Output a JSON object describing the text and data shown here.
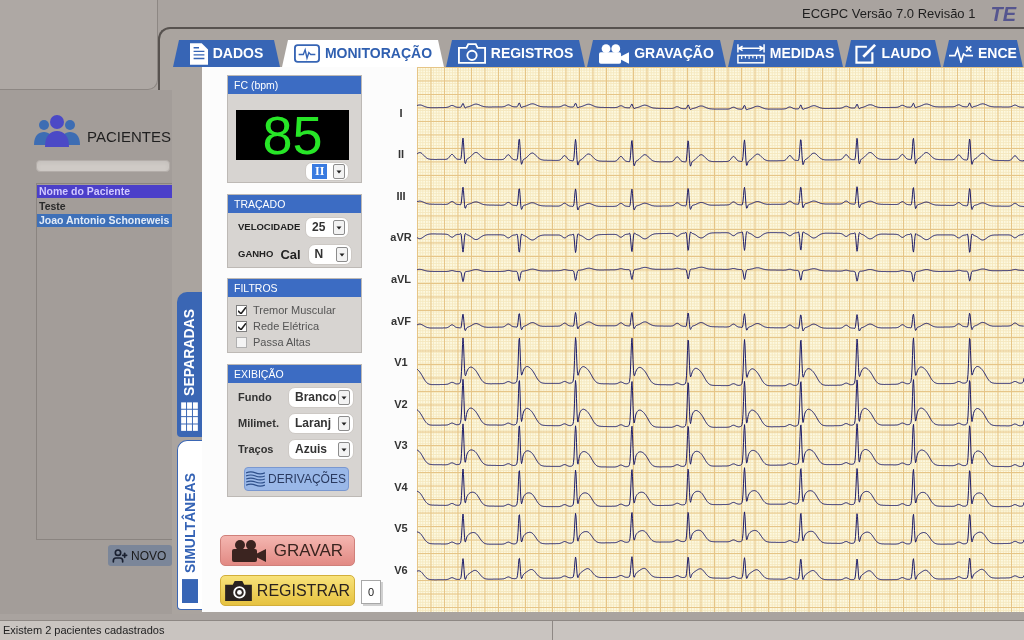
{
  "header": {
    "title": "ECGPC Versão 7.0 Revisão 1",
    "logo": "TE"
  },
  "patients": {
    "title": "PACIENTES",
    "list": {
      "column": "Nome do Paciente",
      "rows": [
        {
          "name": "Teste",
          "selected": false
        },
        {
          "name": "Joao Antonio Schoneweis",
          "selected": true
        }
      ]
    },
    "new_button": "NOVO"
  },
  "tabs": [
    {
      "label": "DADOS",
      "selected": false
    },
    {
      "label": "MONITORAÇÃO",
      "selected": true
    },
    {
      "label": "REGISTROS",
      "selected": false
    },
    {
      "label": "GRAVAÇÃO",
      "selected": false
    },
    {
      "label": "MEDIDAS",
      "selected": false
    },
    {
      "label": "LAUDO",
      "selected": false
    },
    {
      "label": "ENCE",
      "selected": false
    }
  ],
  "view_tabs": [
    {
      "label": "SEPARADAS",
      "selected": false
    },
    {
      "label": "SIMULTÂNEAS",
      "selected": true
    }
  ],
  "heart_rate": {
    "title": "FC (bpm)",
    "value": "85",
    "lead": {
      "value": "II",
      "highlighted": true
    }
  },
  "tracing": {
    "title": "TRAÇADO",
    "speed_label": "VELOCIDADE",
    "speed": "25",
    "gain_label": "GANHO",
    "gain_mode": "Cal",
    "gain": "N"
  },
  "filters": {
    "title": "FILTROS",
    "items": [
      {
        "label": "Tremor Muscular",
        "checked": true
      },
      {
        "label": "Rede Elétrica",
        "checked": true
      },
      {
        "label": "Passa Altas",
        "checked": false
      }
    ]
  },
  "display": {
    "title": "EXIBIÇÃO",
    "rows": [
      {
        "label": "Fundo",
        "value": "Branco"
      },
      {
        "label": "Milimet.",
        "value": "Laranj"
      },
      {
        "label": "Traços",
        "value": "Azuis"
      }
    ],
    "button": "DERIVAÇÕES"
  },
  "actions": {
    "record": "GRAVAR",
    "capture": "REGISTRAR",
    "capture_count": "0"
  },
  "leads": [
    "I",
    "II",
    "III",
    "aVR",
    "aVL",
    "aVF",
    "V1",
    "V2",
    "V3",
    "V4",
    "V5",
    "V6"
  ],
  "status_bar": "Existem 2 pacientes cadastrados"
}
